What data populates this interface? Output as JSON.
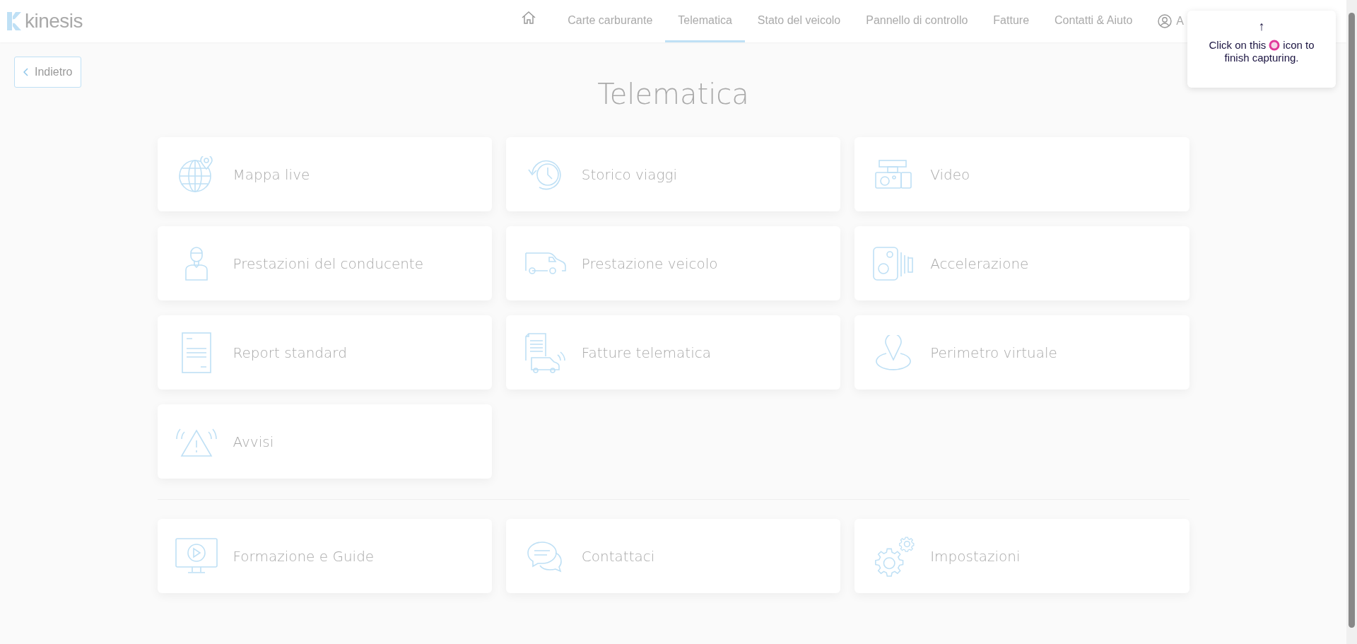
{
  "header": {
    "logo": "kinesis",
    "nav": [
      {
        "label": "Carte carburante",
        "selected": false
      },
      {
        "label": "Telematica",
        "selected": true
      },
      {
        "label": "Stato del veicolo",
        "selected": false
      },
      {
        "label": "Pannello di controllo",
        "selected": false
      },
      {
        "label": "Fatture",
        "selected": false
      },
      {
        "label": "Contatti & Aiuto",
        "selected": false
      }
    ],
    "account": "A"
  },
  "back_button": "Indietro",
  "title": "Telematica",
  "tiles": [
    {
      "label": "Mappa live"
    },
    {
      "label": "Storico viaggi"
    },
    {
      "label": "Video"
    },
    {
      "label": "Prestazioni del conducente"
    },
    {
      "label": "Prestazione veicolo"
    },
    {
      "label": "Accelerazione"
    },
    {
      "label": "Report standard"
    },
    {
      "label": "Fatture telematica"
    },
    {
      "label": "Perimetro virtuale"
    },
    {
      "label": "Avvisi"
    }
  ],
  "bottom_tiles": [
    {
      "label": "Formazione e Guide"
    },
    {
      "label": "Contattaci"
    },
    {
      "label": "Impostazioni"
    }
  ],
  "tooltip": {
    "arrow": "↑",
    "text_before": "Click on this",
    "text_after": "icon to",
    "second_line": "finish capturing."
  }
}
